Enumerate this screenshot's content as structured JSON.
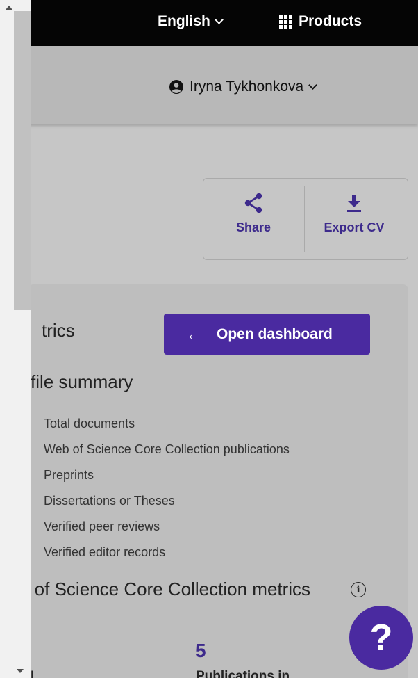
{
  "header": {
    "language_label": "English",
    "products_label": "Products"
  },
  "user": {
    "name": "Iryna Tykhonkova"
  },
  "actions": {
    "share_label": "Share",
    "export_label": "Export CV"
  },
  "metrics": {
    "section_title": "trics",
    "open_dashboard_label": "Open dashboard",
    "profile_summary_title": "file summary",
    "summary_items": [
      "Total documents",
      "Web of Science Core Collection publications",
      "Preprints",
      "Dissertations or Theses",
      "Verified peer reviews",
      "Verified editor records"
    ],
    "core_metrics_title": "o of Science Core Collection metrics",
    "stat_value": "5",
    "stat_label": "Publications in",
    "stat_label_left": "I"
  },
  "help": {
    "label": "?"
  },
  "colors": {
    "accent": "#4a2aa0",
    "topbar": "#050505"
  }
}
